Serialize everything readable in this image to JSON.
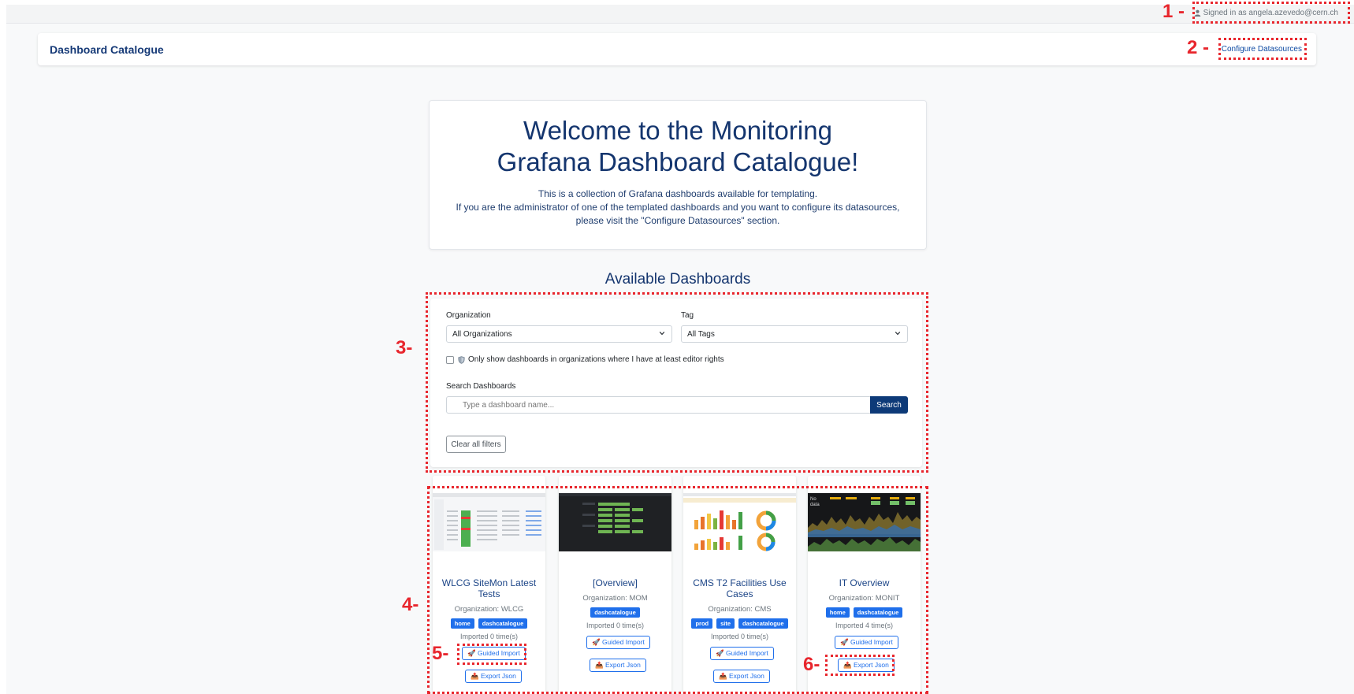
{
  "user": {
    "signed_in": "Signed in as angela.azevedo@cern.ch"
  },
  "header": {
    "brand": "Dashboard Catalogue",
    "configure": "Configure Datasources"
  },
  "welcome": {
    "title": "Welcome to the Monitoring Grafana Dashboard Catalogue!",
    "line1": "This is a collection of Grafana dashboards available for templating.",
    "line2": "If you are the administrator of one of the templated dashboards and you want to configure its datasources, please visit the \"Configure Datasources\" section."
  },
  "available": {
    "title": "Available Dashboards"
  },
  "filters": {
    "org_label": "Organization",
    "org_value": "All Organizations",
    "tag_label": "Tag",
    "tag_value": "All Tags",
    "editor_only": "Only show dashboards in organizations where I have at least editor rights",
    "search_label": "Search Dashboards",
    "search_placeholder": "Type a dashboard name...",
    "search_button": "Search",
    "clear_button": "Clear all filters"
  },
  "buttons": {
    "guided_import": "🚀 Guided Import",
    "export_json": "📤 Export Json"
  },
  "dashboards": [
    {
      "title": "WLCG SiteMon Latest Tests",
      "org": "Organization: WLCG",
      "tags": [
        "home",
        "dashcatalogue"
      ],
      "imported": "Imported 0 time(s)"
    },
    {
      "title": "[Overview]",
      "org": "Organization: MOM",
      "tags": [
        "dashcatalogue"
      ],
      "imported": "Imported 0 time(s)"
    },
    {
      "title": "CMS T2 Facilities Use Cases",
      "org": "Organization: CMS",
      "tags": [
        "prod",
        "site",
        "dashcatalogue"
      ],
      "imported": "Imported 0 time(s)"
    },
    {
      "title": "IT Overview",
      "org": "Organization: MONIT",
      "tags": [
        "home",
        "dashcatalogue"
      ],
      "imported": "Imported 4 time(s)"
    }
  ],
  "annotations": [
    "1 -",
    "2 -",
    "3-",
    "4-",
    "5-",
    "6-"
  ],
  "colors": {
    "brand": "#163a77",
    "accent": "#1f6feb",
    "annotation": "#e8262d",
    "search_button": "#0d3a78"
  }
}
